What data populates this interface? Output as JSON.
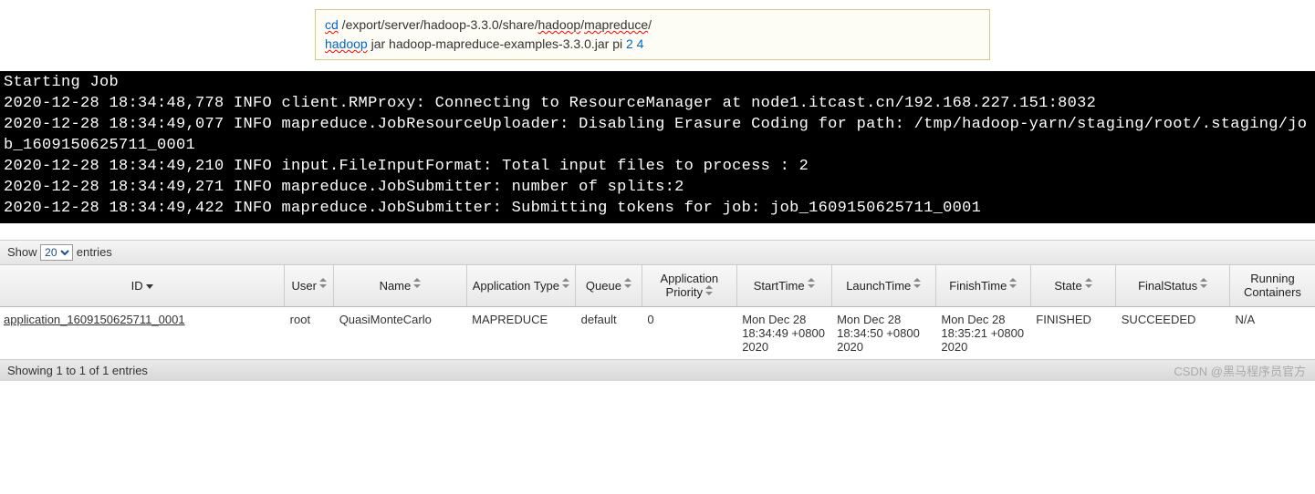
{
  "codebox": {
    "line1": {
      "cmd": "cd",
      "path_pre": " /export/server/hadoop-3.3.0/share/",
      "wavy1": "hadoop",
      "slash1": "/",
      "wavy2": "mapreduce",
      "slash2": "/"
    },
    "line2": {
      "cmd": "hadoop",
      "rest": " jar hadoop-mapreduce-examples-3.3.0.jar pi ",
      "n1": "2",
      "space": " ",
      "n2": "4"
    }
  },
  "terminal": "Starting Job\n2020-12-28 18:34:48,778 INFO client.RMProxy: Connecting to ResourceManager at node1.itcast.cn/192.168.227.151:8032\n2020-12-28 18:34:49,077 INFO mapreduce.JobResourceUploader: Disabling Erasure Coding for path: /tmp/hadoop-yarn/staging/root/.staging/job_1609150625711_0001\n2020-12-28 18:34:49,210 INFO input.FileInputFormat: Total input files to process : 2\n2020-12-28 18:34:49,271 INFO mapreduce.JobSubmitter: number of splits:2\n2020-12-28 18:34:49,422 INFO mapreduce.JobSubmitter: Submitting tokens for job: job_1609150625711_0001",
  "showbar": {
    "show": "Show",
    "value": "20",
    "entries": "entries"
  },
  "columns": [
    "ID",
    "User",
    "Name",
    "Application Type",
    "Queue",
    "Application Priority",
    "StartTime",
    "LaunchTime",
    "FinishTime",
    "State",
    "FinalStatus",
    "Running Containers"
  ],
  "row": {
    "id": "application_1609150625711_0001",
    "user": "root",
    "name": "QuasiMonteCarlo",
    "apptype": "MAPREDUCE",
    "queue": "default",
    "priority": "0",
    "start": "Mon Dec 28 18:34:49 +0800 2020",
    "launch": "Mon Dec 28 18:34:50 +0800 2020",
    "finish": "Mon Dec 28 18:35:21 +0800 2020",
    "state": "FINISHED",
    "finalstatus": "SUCCEEDED",
    "running": "N/A"
  },
  "footer": "Showing 1 to 1 of 1 entries",
  "watermark": "CSDN @黑马程序员官方"
}
